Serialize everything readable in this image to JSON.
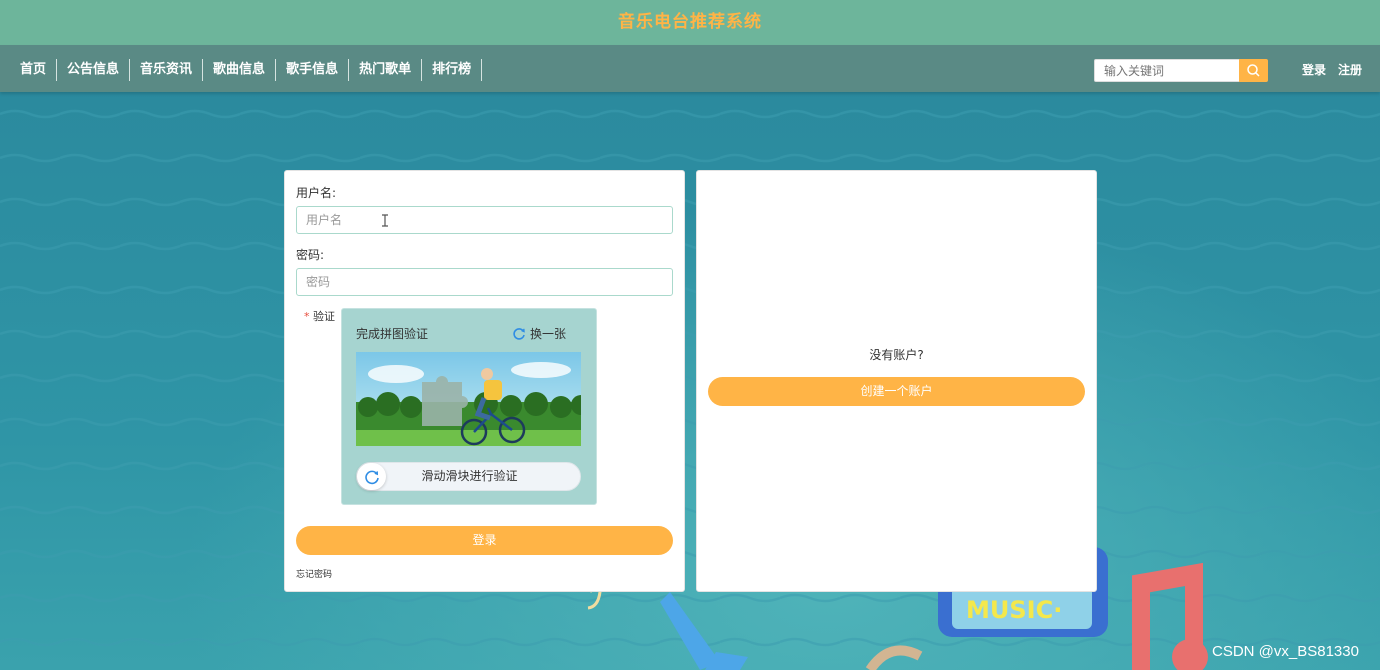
{
  "header": {
    "title": "音乐电台推荐系统"
  },
  "nav": {
    "items": [
      {
        "label": "首页"
      },
      {
        "label": "公告信息"
      },
      {
        "label": "音乐资讯"
      },
      {
        "label": "歌曲信息"
      },
      {
        "label": "歌手信息"
      },
      {
        "label": "热门歌单"
      },
      {
        "label": "排行榜"
      }
    ],
    "search_placeholder": "输入关键词",
    "login": "登录",
    "register": "注册"
  },
  "login_form": {
    "username_label": "用户名:",
    "username_placeholder": "用户名",
    "password_label": "密码:",
    "password_placeholder": "密码",
    "required_mark": "*",
    "captcha_label": "验证",
    "captcha_title": "完成拼图验证",
    "captcha_refresh": "换一张",
    "slider_text": "滑动滑块进行验证",
    "submit": "登录",
    "forgot": "忘记密码"
  },
  "register_panel": {
    "prompt": "没有账户?",
    "create_button": "创建一个账户"
  },
  "background": {
    "sign_text": "MUSIC·"
  },
  "watermark": "CSDN @vx_BS81330",
  "colors": {
    "accent": "#ffb446",
    "topbar": "#6db59b",
    "navbar": "#5a8a85",
    "field_border": "#aad9cc"
  }
}
